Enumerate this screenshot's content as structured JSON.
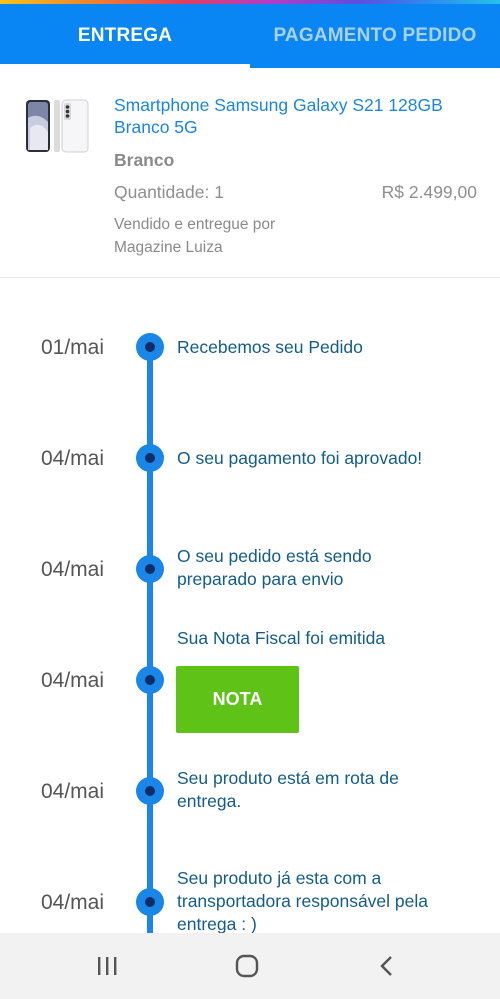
{
  "tabs": [
    {
      "label": "ENTREGA",
      "active": true
    },
    {
      "label": "PAGAMENTO PEDIDO",
      "active": false
    }
  ],
  "product": {
    "image_icon": "smartphone-product-image",
    "name": "Smartphone Samsung Galaxy S21 128GB Branco 5G",
    "color": "Branco",
    "quantity": "Quantidade: 1",
    "price": "R$ 2.499,00",
    "sold_by_line1": "Vendido e entregue por",
    "sold_by_line2": "Magazine Luiza"
  },
  "timeline": [
    {
      "date": "01/mai",
      "text": "Recebemos seu Pedido"
    },
    {
      "date": "04/mai",
      "text": "O seu pagamento foi aprovado!"
    },
    {
      "date": "04/mai",
      "text": "O seu pedido está sendo preparado para envio"
    },
    {
      "date": "04/mai",
      "text": "Sua Nota Fiscal foi emitida",
      "button": "NOTA"
    },
    {
      "date": "04/mai",
      "text": "Seu produto está em rota de entrega."
    },
    {
      "date": "04/mai",
      "text": "Seu produto já esta com a transportadora responsável pela entrega : )"
    }
  ],
  "navbar": {
    "recent_icon": "recent-apps-icon",
    "home_icon": "home-icon",
    "back_icon": "back-icon"
  },
  "colors": {
    "primary": "#0a86f4",
    "timeline": "#1a86e8",
    "nota_button": "#5ec217",
    "event_text": "#135c8d"
  }
}
